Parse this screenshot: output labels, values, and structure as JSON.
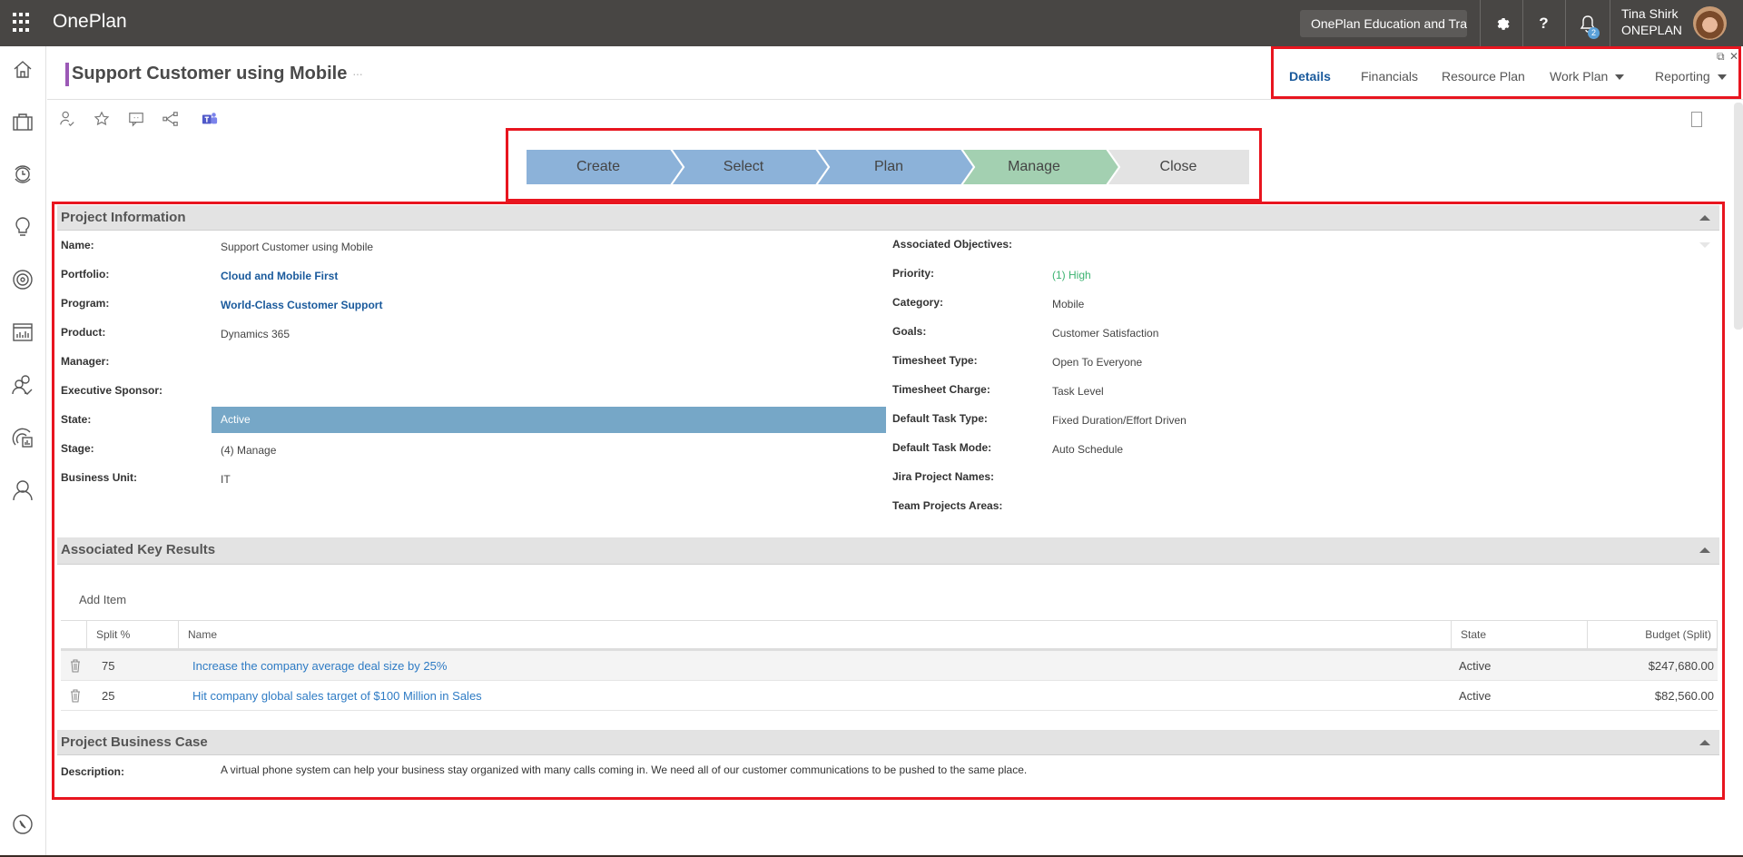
{
  "topbar": {
    "app_title": "OnePlan",
    "environment": "OnePlan Education and Training",
    "notifications_count": "2",
    "user_name": "Tina Shirk",
    "user_org": "ONEPLAN",
    "icons": [
      "app-launcher-icon",
      "settings-icon",
      "help-icon",
      "notification-bell-icon"
    ]
  },
  "sidebar": {
    "items": [
      {
        "name": "home",
        "icon": "home-icon"
      },
      {
        "name": "portfolio",
        "icon": "briefcase-icon"
      },
      {
        "name": "timesheet",
        "icon": "clock-icon"
      },
      {
        "name": "ideas",
        "icon": "lightbulb-icon"
      },
      {
        "name": "objectives",
        "icon": "target-icon"
      },
      {
        "name": "reports",
        "icon": "chart-icon"
      },
      {
        "name": "resources",
        "icon": "people-check-icon"
      },
      {
        "name": "analytics",
        "icon": "report-icon"
      },
      {
        "name": "profile",
        "icon": "person-icon"
      },
      {
        "name": "explore",
        "icon": "compass-icon"
      }
    ]
  },
  "page": {
    "title": "Support Customer using Mobile",
    "more": "···"
  },
  "tabs": [
    {
      "label": "Details",
      "active": true
    },
    {
      "label": "Financials",
      "active": false
    },
    {
      "label": "Resource Plan",
      "active": false
    },
    {
      "label": "Work Plan",
      "active": false,
      "dropdown": true
    },
    {
      "label": "Reporting",
      "active": false,
      "dropdown": true
    }
  ],
  "window_controls": {
    "popout": "⧉",
    "close": "✕"
  },
  "toolbar": [
    "assign-person-icon",
    "favorite-star-icon",
    "comment-icon",
    "share-icon",
    "teams-icon"
  ],
  "stages": [
    {
      "label": "Create",
      "status": "complete",
      "color": "#8cb2d9"
    },
    {
      "label": "Select",
      "status": "complete",
      "color": "#8cb2d9"
    },
    {
      "label": "Plan",
      "status": "complete",
      "color": "#8cb2d9"
    },
    {
      "label": "Manage",
      "status": "current",
      "color": "#a3d0b1"
    },
    {
      "label": "Close",
      "status": "future",
      "color": "#e3e3e3"
    }
  ],
  "project_information": {
    "title": "Project Information",
    "left": [
      {
        "label": "Name:",
        "value": "Support Customer using Mobile",
        "type": "text"
      },
      {
        "label": "Portfolio:",
        "value": "Cloud and Mobile First",
        "type": "link"
      },
      {
        "label": "Program:",
        "value": "World-Class Customer Support",
        "type": "link"
      },
      {
        "label": "Product:",
        "value": "Dynamics 365",
        "type": "text"
      },
      {
        "label": "Manager:",
        "value": "",
        "type": "text"
      },
      {
        "label": "Executive Sponsor:",
        "value": "",
        "type": "text"
      },
      {
        "label": "State:",
        "value": "Active",
        "type": "state"
      },
      {
        "label": "Stage:",
        "value": "(4) Manage",
        "type": "text"
      },
      {
        "label": "Business Unit:",
        "value": "IT",
        "type": "text"
      }
    ],
    "right": [
      {
        "label": "Associated Objectives:",
        "value": "",
        "type": "text"
      },
      {
        "label": "Priority:",
        "value": "(1) High",
        "type": "green"
      },
      {
        "label": "Category:",
        "value": "Mobile",
        "type": "text"
      },
      {
        "label": "Goals:",
        "value": "Customer Satisfaction",
        "type": "text"
      },
      {
        "label": "Timesheet Type:",
        "value": "Open To Everyone",
        "type": "text"
      },
      {
        "label": "Timesheet Charge:",
        "value": "Task Level",
        "type": "text"
      },
      {
        "label": "Default Task Type:",
        "value": "Fixed Duration/Effort Driven",
        "type": "text"
      },
      {
        "label": "Default Task Mode:",
        "value": "Auto Schedule",
        "type": "text"
      },
      {
        "label": "Jira Project Names:",
        "value": "",
        "type": "text"
      },
      {
        "label": "Team Projects Areas:",
        "value": "",
        "type": "text"
      }
    ]
  },
  "key_results": {
    "title": "Associated Key Results",
    "add_item": "Add Item",
    "columns": [
      "",
      "Split %",
      "Name",
      "State",
      "Budget (Split)"
    ],
    "rows": [
      {
        "split": "75",
        "name": "Increase the company average deal size by 25%",
        "state": "Active",
        "budget": "$247,680.00"
      },
      {
        "split": "25",
        "name": "Hit company global sales target of $100 Million in Sales",
        "state": "Active",
        "budget": "$82,560.00"
      }
    ]
  },
  "business_case": {
    "title": "Project Business Case",
    "description_label": "Description:",
    "description": "A virtual phone system can help your business stay organized with many calls coming in.  We need all of our customer communications to be pushed to the same place."
  },
  "colors": {
    "topbar": "#484644",
    "accent_link": "#1a5a9c",
    "state_bar": "#76a7c7",
    "highlight_border": "#e8151f",
    "title_accent": "#9b59b6"
  }
}
